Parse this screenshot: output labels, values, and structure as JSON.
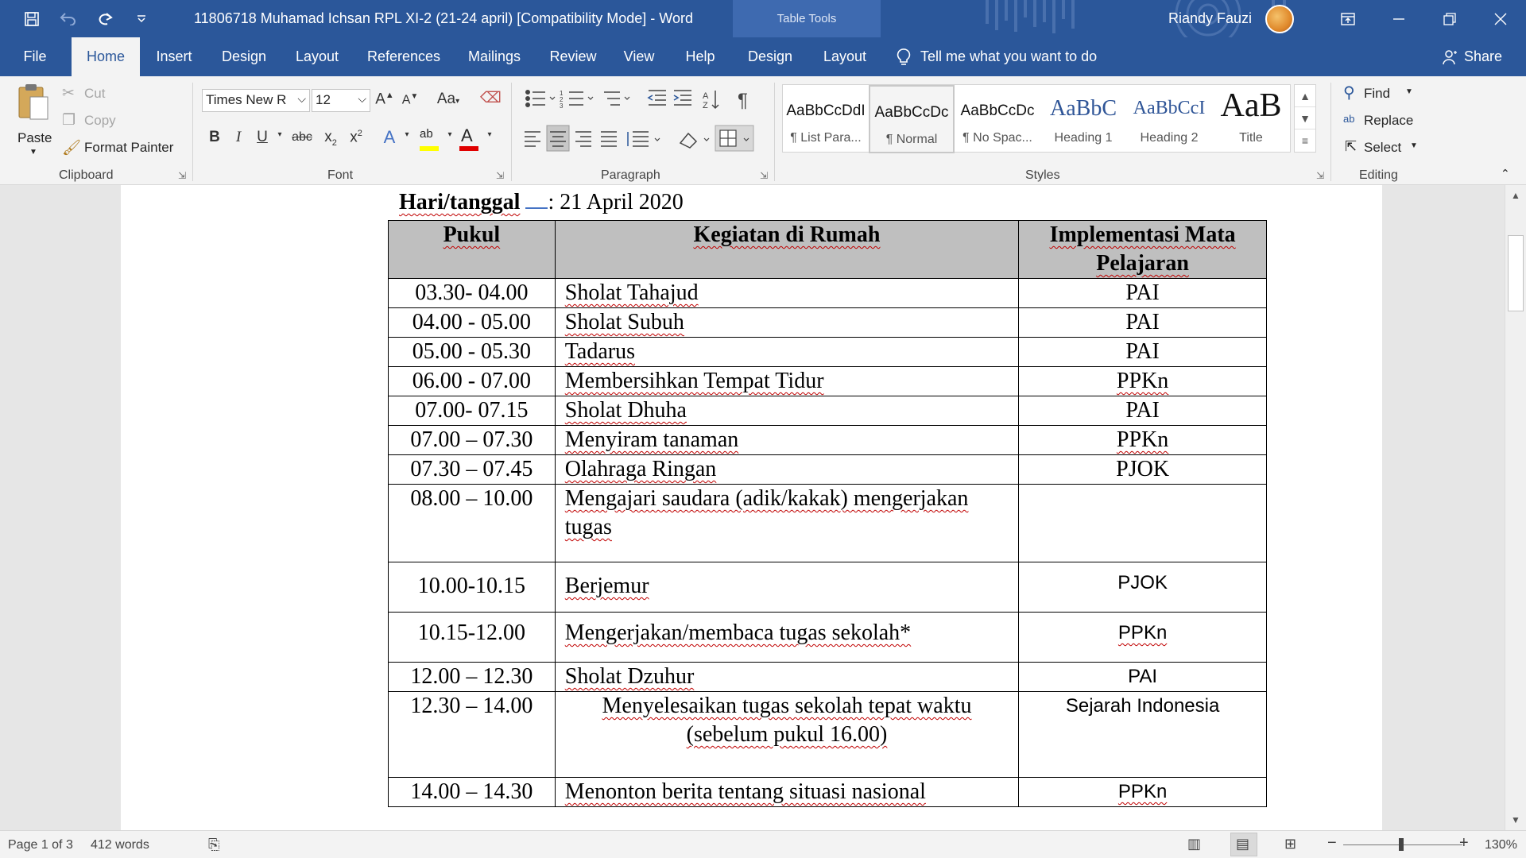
{
  "window": {
    "title": "11806718 Muhamad Ichsan RPL XI-2 (21-24 april) [Compatibility Mode]  -  Word",
    "context_header": "Table Tools",
    "user": "Riandy Fauzi"
  },
  "tabs": [
    "File",
    "Home",
    "Insert",
    "Design",
    "Layout",
    "References",
    "Mailings",
    "Review",
    "View",
    "Help",
    "Design",
    "Layout"
  ],
  "active_tab": "Home",
  "tell_me": "Tell me what you want to do",
  "share": "Share",
  "clipboard": {
    "paste": "Paste",
    "cut": "Cut",
    "copy": "Copy",
    "format_painter": "Format Painter",
    "label": "Clipboard"
  },
  "font": {
    "name": "Times New R",
    "size": "12",
    "label": "Font",
    "grow": "A",
    "shrink": "A",
    "case": "Aa",
    "bold": "B",
    "italic": "I",
    "underline": "U",
    "strike": "abc",
    "sub": "x",
    "sup": "x"
  },
  "paragraph": {
    "label": "Paragraph"
  },
  "styles": {
    "label": "Styles",
    "items": [
      {
        "preview": "AaBbCcDdI",
        "name": "¶ List Para..."
      },
      {
        "preview": "AaBbCcDc",
        "name": "¶ Normal"
      },
      {
        "preview": "AaBbCcDc",
        "name": "¶ No Spac..."
      },
      {
        "preview": "AaBbC",
        "name": "Heading 1"
      },
      {
        "preview": "AaBbCcI",
        "name": "Heading 2"
      },
      {
        "preview": "AaB",
        "name": "Title"
      }
    ],
    "selected_index": 1
  },
  "editing": {
    "find": "Find",
    "replace": "Replace",
    "select": "Select",
    "label": "Editing"
  },
  "document": {
    "date_label": "Hari/tanggal",
    "date_value": ": 21 April 2020",
    "headers": [
      "Pukul",
      "Kegiatan di Rumah",
      "Implementasi Mata Pelajaran"
    ],
    "rows": [
      {
        "time": "03.30- 04.00",
        "activity": "Sholat Tahajud",
        "subject": "PAI"
      },
      {
        "time": "04.00 - 05.00",
        "activity": "Sholat Subuh",
        "subject": "PAI"
      },
      {
        "time": "05.00 - 05.30",
        "activity": "Tadarus",
        "subject": "PAI"
      },
      {
        "time": "06.00 - 07.00",
        "activity": "Membersihkan Tempat Tidur",
        "subject": "PPKn"
      },
      {
        "time": "07.00- 07.15",
        "activity": "Sholat Dhuha",
        "subject": "PAI"
      },
      {
        "time": "07.00 – 07.30",
        "activity": "Menyiram tanaman",
        "subject": "PPKn"
      },
      {
        "time": "07.30 – 07.45",
        "activity": "Olahraga Ringan",
        "subject": "PJOK"
      },
      {
        "time": "08.00 – 10.00",
        "activity": "Mengajari saudara (adik/kakak) mengerjakan tugas",
        "subject": ""
      },
      {
        "time": "10.00-10.15",
        "activity": "Berjemur",
        "subject": "PJOK"
      },
      {
        "time": "10.15-12.00",
        "activity": "Mengerjakan/membaca tugas sekolah*",
        "subject": "PPKn"
      },
      {
        "time": "12.00 – 12.30",
        "activity": "Sholat Dzuhur",
        "subject": "PAI"
      },
      {
        "time": "12.30 – 14.00",
        "activity": "Menyelesaikan tugas sekolah tepat waktu (sebelum pukul 16.00)",
        "subject": "Sejarah Indonesia"
      },
      {
        "time": "14.00 – 14.30",
        "activity": "Menonton berita tentang situasi nasional",
        "subject": "PPKn"
      }
    ]
  },
  "status": {
    "page": "Page 1 of 3",
    "words": "412 words",
    "zoom": "130%"
  },
  "colors": {
    "ribbon_blue": "#2b579a",
    "context_blue": "#3e6ab0",
    "header_gray": "#bfbfbf",
    "squiggle_red": "#c00000"
  }
}
